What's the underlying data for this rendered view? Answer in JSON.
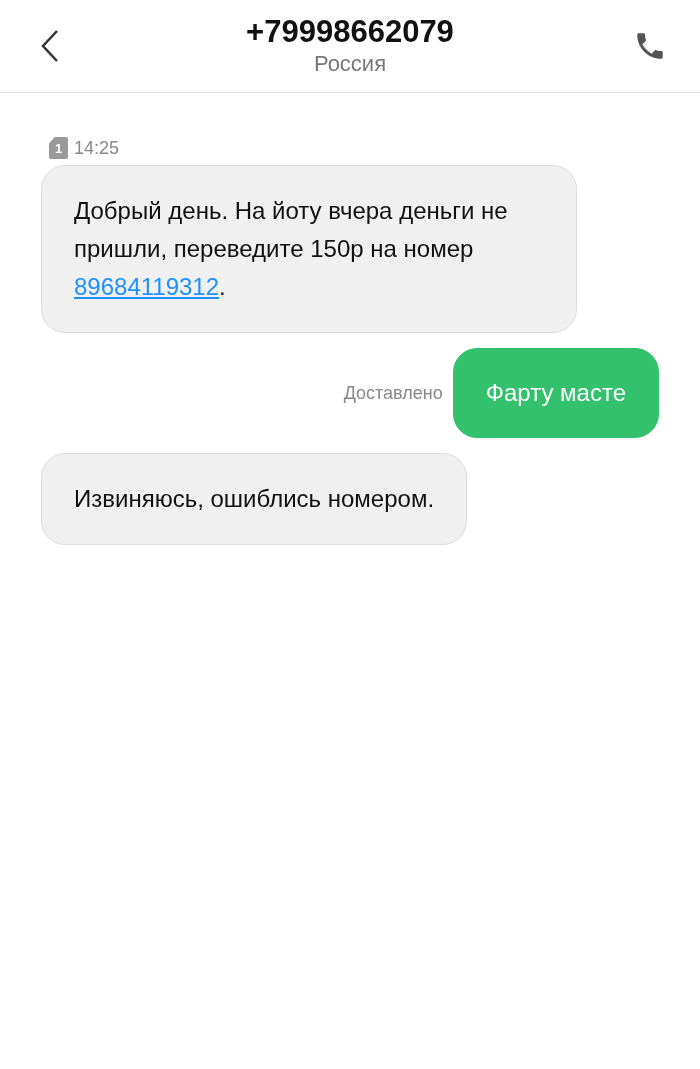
{
  "header": {
    "title": "+79998662079",
    "subtitle": "Россия"
  },
  "timestamp": {
    "sim_slot": "1",
    "time": "14:25"
  },
  "messages": [
    {
      "kind": "incoming",
      "parts": [
        {
          "kind": "text",
          "text": "Добрый день. На йоту вчера деньги не пришли, переведите 150р на номер "
        },
        {
          "kind": "link",
          "text": "89684119312"
        },
        {
          "kind": "text",
          "text": "."
        }
      ]
    },
    {
      "kind": "outgoing",
      "status": "Доставлено",
      "parts": [
        {
          "kind": "text",
          "text": "Фарту масте"
        }
      ]
    },
    {
      "kind": "incoming",
      "parts": [
        {
          "kind": "text",
          "text": "Извиняюсь, ошиблись номером."
        }
      ]
    }
  ]
}
